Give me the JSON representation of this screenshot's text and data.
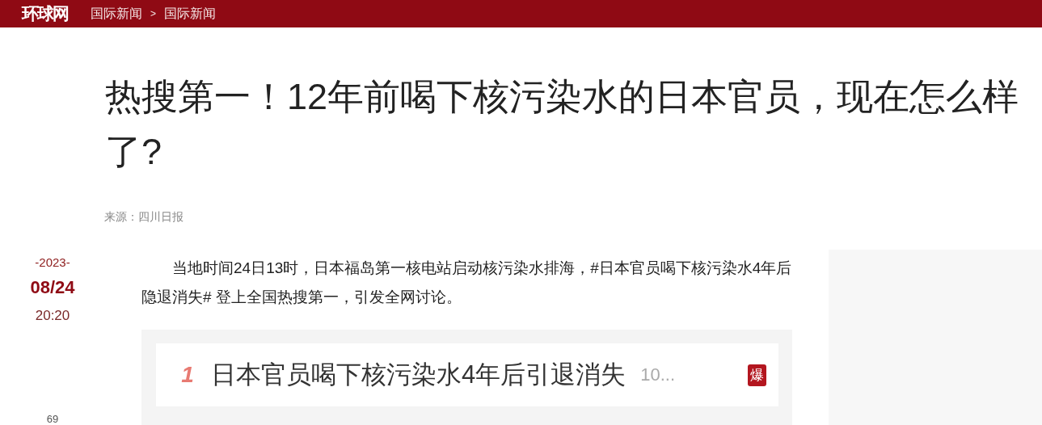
{
  "header": {
    "logo": "环球网",
    "breadcrumb": [
      {
        "label": "国际新闻"
      },
      {
        "label": "国际新闻"
      }
    ],
    "separator": ">"
  },
  "article": {
    "title": "热搜第一！12年前喝下核污染水的日本官员，现在怎么样了?",
    "source": "来源：四川日报",
    "date": {
      "year": "-2023-",
      "day": "08/24",
      "time": "20:20",
      "count": "69"
    },
    "paragraph": "当地时间24日13时，日本福岛第一核电站启动核污染水排海，#日本官员喝下核污染水4年后隐退消失# 登上全国热搜第一，引发全网讨论。",
    "hot_search": {
      "rank": "1",
      "title": "日本官员喝下核污染水4年后引退消失",
      "count": "10...",
      "badge": "爆"
    }
  },
  "side_panel": {
    "kind": "placeholder"
  }
}
